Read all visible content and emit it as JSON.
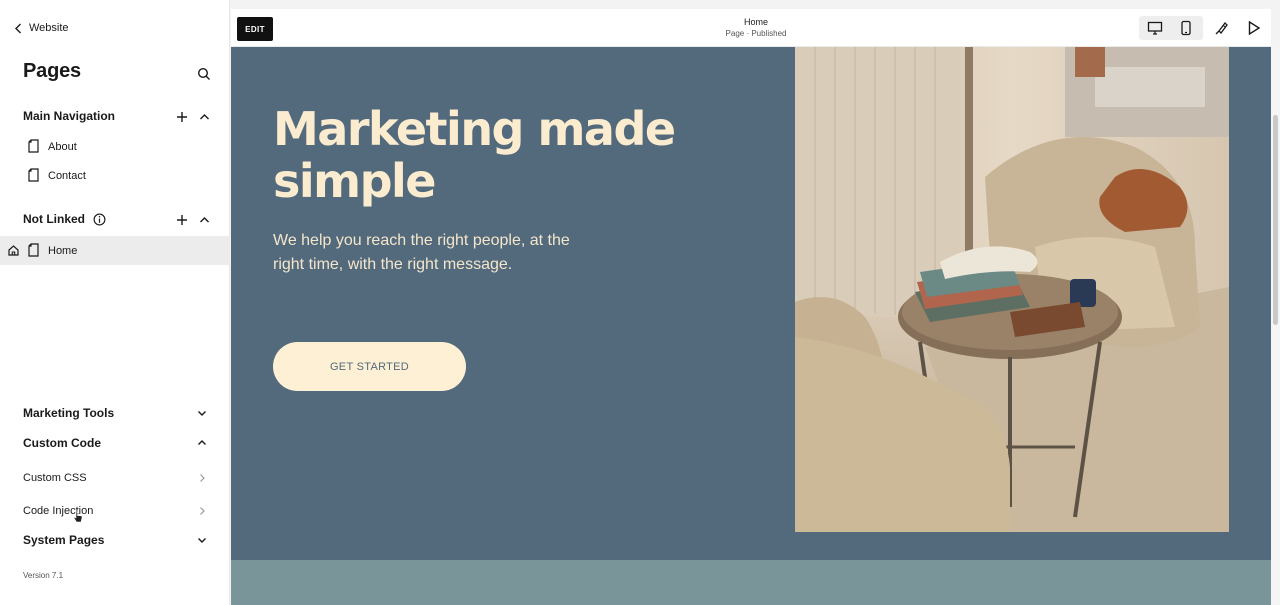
{
  "sidebar": {
    "back_label": "Website",
    "title": "Pages",
    "main_nav": {
      "label": "Main Navigation",
      "items": [
        {
          "label": "About"
        },
        {
          "label": "Contact"
        }
      ]
    },
    "not_linked": {
      "label": "Not Linked",
      "items": [
        {
          "label": "Home"
        }
      ]
    },
    "marketing_tools": "Marketing Tools",
    "custom_code": {
      "label": "Custom Code",
      "items": [
        {
          "label": "Custom CSS"
        },
        {
          "label": "Code Injection"
        }
      ]
    },
    "system_pages": "System Pages",
    "version": "Version 7.1"
  },
  "topbar": {
    "edit_label": "EDIT",
    "page_title": "Home",
    "page_status": "Page · Published",
    "icons": [
      "desktop-icon",
      "mobile-icon",
      "design-brush-icon",
      "preview-play-icon"
    ]
  },
  "hero": {
    "title": "Marketing made simple",
    "subtitle": "We help you reach the right people, at the right time, with the right message.",
    "cta_label": "GET STARTED"
  },
  "colors": {
    "hero_bg": "#536a7c",
    "hero_text": "#fbecd0",
    "cta_bg": "#fdf0d5",
    "next_section_bg": "#7a959a"
  }
}
